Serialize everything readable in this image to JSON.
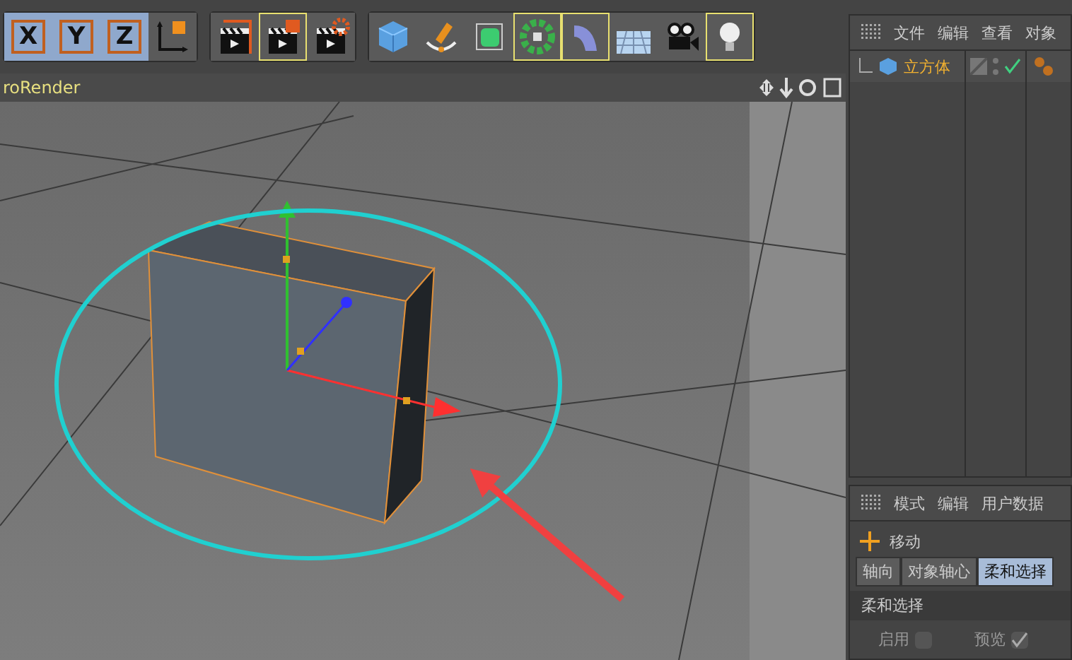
{
  "toolbar": {
    "axis_buttons": [
      {
        "label": "X",
        "on": true
      },
      {
        "label": "Y",
        "on": true
      },
      {
        "label": "Z",
        "on": true
      }
    ],
    "tools": [
      {
        "kind": "coords",
        "highlighted": false
      },
      {
        "kind": "render-view",
        "highlighted": false
      },
      {
        "kind": "render-picture",
        "highlighted": true
      },
      {
        "kind": "render-settings",
        "highlighted": false
      },
      {
        "kind": "cube",
        "highlighted": false
      },
      {
        "kind": "pen",
        "highlighted": false
      },
      {
        "kind": "subdivision",
        "highlighted": false
      },
      {
        "kind": "cloner",
        "highlighted": true
      },
      {
        "kind": "bend",
        "highlighted": true
      },
      {
        "kind": "floor",
        "highlighted": false
      },
      {
        "kind": "camera",
        "highlighted": false
      },
      {
        "kind": "light",
        "highlighted": true
      }
    ]
  },
  "viewport": {
    "title": "roRender"
  },
  "object_manager": {
    "menu": [
      "文件",
      "编辑",
      "查看",
      "对象"
    ],
    "objects": [
      {
        "name": "立方体",
        "selected": true,
        "enabled": true
      }
    ]
  },
  "attribute_manager": {
    "menu": [
      "模式",
      "编辑",
      "用户数据"
    ],
    "tool": "移动",
    "tabs": [
      {
        "label": "轴向",
        "selected": false
      },
      {
        "label": "对象轴心",
        "selected": false
      },
      {
        "label": "柔和选择",
        "selected": true
      }
    ],
    "section": "柔和选择",
    "options": [
      {
        "label": "启用",
        "checked": false
      },
      {
        "label": "预览",
        "checked": true
      }
    ]
  }
}
